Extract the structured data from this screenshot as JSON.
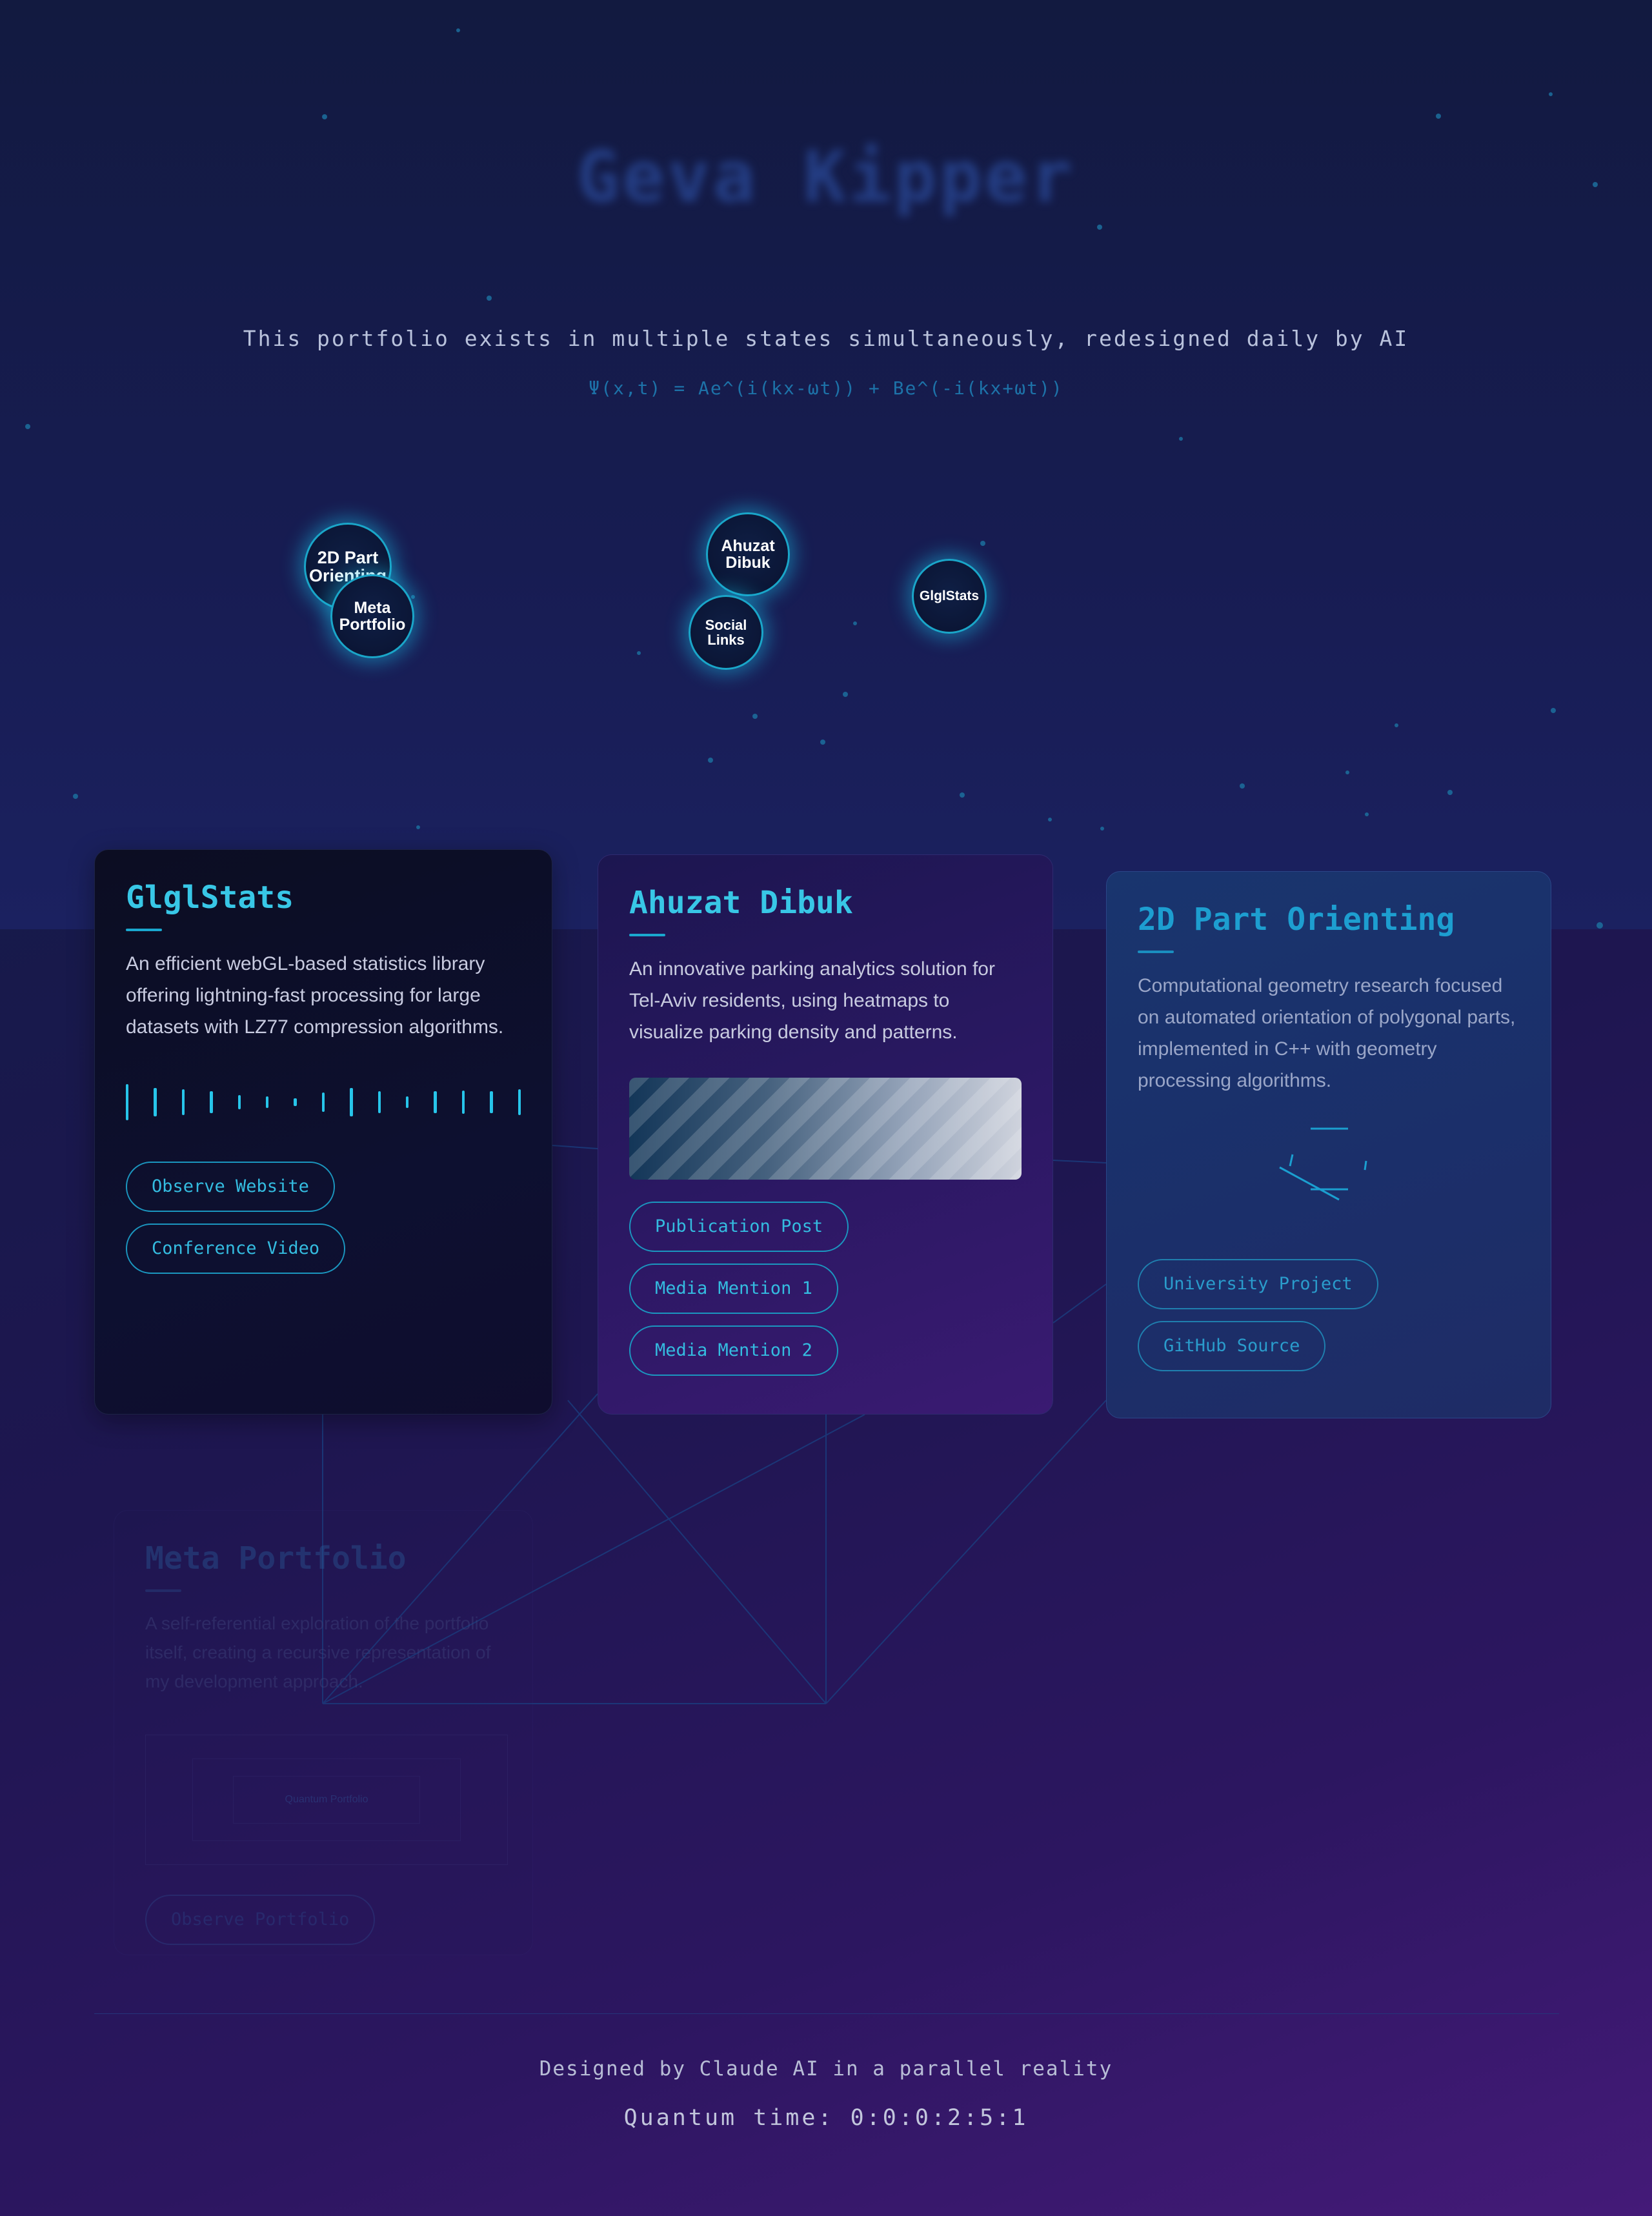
{
  "hero": {
    "title": "Geva Kipper",
    "tagline": "This portfolio exists in multiple states simultaneously, redesigned daily by AI",
    "equation": "Ψ(x,t) = Ae^(i(kx-ωt)) + Be^(-i(kx+ωt))"
  },
  "nodes": {
    "part_orienting": "2D Part Orienting",
    "meta_portfolio": "Meta Portfolio",
    "ahuzat_dibuk": "Ahuzat Dibuk",
    "social_links": "Social Links",
    "glglstats": "GlglStats"
  },
  "projects": {
    "glglstats": {
      "title": "GlglStats",
      "description": "An efficient webGL-based statistics library offering lightning-fast processing for large datasets with LZ77 compression algorithms.",
      "buttons": [
        "Observe Website",
        "Conference Video"
      ]
    },
    "ahuzat": {
      "title": "Ahuzat Dibuk",
      "description": "An innovative parking analytics solution for Tel-Aviv residents, using heatmaps to visualize parking density and patterns.",
      "buttons": [
        "Publication Post",
        "Media Mention 1",
        "Media Mention 2"
      ]
    },
    "part2d": {
      "title": "2D Part Orienting",
      "description": "Computational geometry research focused on automated orientation of polygonal parts, implemented in C++ with geometry processing algorithms.",
      "buttons": [
        "University Project",
        "GitHub Source"
      ]
    },
    "meta": {
      "title": "Meta Portfolio",
      "description": "A self-referential exploration of the portfolio itself, creating a recursive representation of my development approach.",
      "preview_label": "Quantum Portfolio",
      "buttons": [
        "Observe Portfolio"
      ]
    }
  },
  "footer": {
    "credit": "Designed by Claude AI in a parallel reality",
    "quantum_time": "Quantum time: 0:0:0:2:5:1"
  },
  "colors": {
    "accent": "#38c7e6",
    "node_glow": "#1aa6c9",
    "background_end": "#441a78"
  }
}
